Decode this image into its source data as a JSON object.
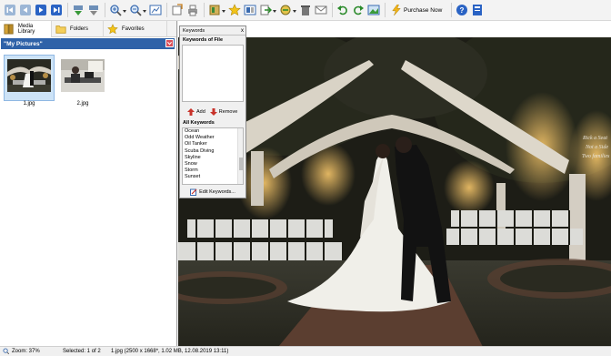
{
  "toolbar": {
    "buttons": [
      "first-icon",
      "previous-icon",
      "next-icon",
      "last-icon",
      "rotate-down-icon",
      "rotate-up-icon",
      "zoom-in-icon",
      "zoom-out-icon",
      "fit-window-icon",
      "open-folder-icon",
      "print-icon",
      "tools-icon",
      "star-icon",
      "metadata-icon",
      "convert-icon",
      "wallpaper-icon",
      "delete-icon",
      "email-icon",
      "undo-icon",
      "redo-icon",
      "edit-image-icon"
    ],
    "purchase_label": "Purchase Now",
    "help_icon": "help-icon",
    "info_icon": "info-icon"
  },
  "tabs": [
    {
      "label": "Media Library",
      "icon": "media-library-icon"
    },
    {
      "label": "Folders",
      "icon": "folder-icon"
    },
    {
      "label": "Favorites",
      "icon": "star-icon"
    }
  ],
  "folder": {
    "title": "\"My Pictures\""
  },
  "thumbnails": [
    {
      "name": "1.jpg",
      "selected": true
    },
    {
      "name": "2.jpg",
      "selected": false
    }
  ],
  "keywords_panel": {
    "title": "Keywords",
    "close": "x",
    "keywords_of_file_label": "Keywords of File",
    "add_label": "Add",
    "remove_label": "Remove",
    "all_keywords_label": "All Keywords",
    "all_keywords": [
      "Ocean",
      "Odd Weather",
      "Oil Tanker",
      "Scuba Diving",
      "Skyline",
      "Snow",
      "Storm",
      "Sunset"
    ],
    "edit_label": "Edit Keywords..."
  },
  "status": {
    "zoom": "Zoom: 37%",
    "selected": "Selected: 1 of 2",
    "file_info": "1.jpg  (2500 x 1668*, 1.02 MB, 12.08.2019 13:11)"
  },
  "colors": {
    "folder_bar": "#2f62a8",
    "selection": "#cde3f7"
  }
}
